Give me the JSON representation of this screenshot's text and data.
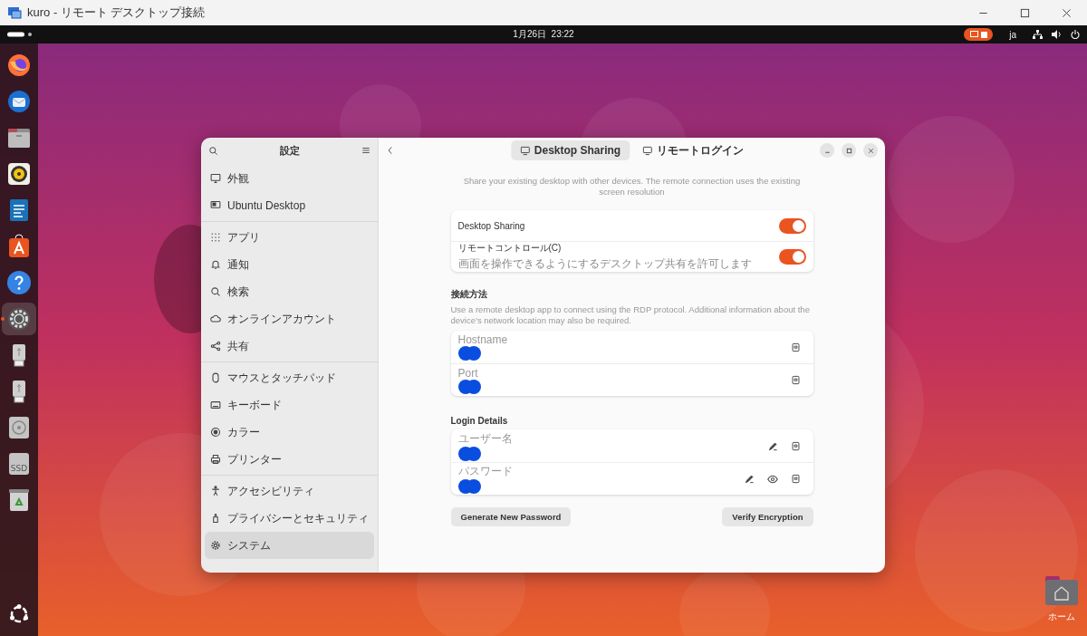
{
  "window": {
    "title": "kuro - リモート デスクトップ接続"
  },
  "top_bar": {
    "clock": "1月26日  23:22",
    "language": "ja",
    "recording": true
  },
  "dock": {
    "items": [
      {
        "kind": "firefox",
        "selected": false
      },
      {
        "kind": "thunderbird",
        "selected": false
      },
      {
        "kind": "files",
        "selected": false
      },
      {
        "kind": "rhythmbox",
        "selected": false
      },
      {
        "kind": "writer",
        "selected": false
      },
      {
        "kind": "appcenter",
        "selected": false
      },
      {
        "kind": "help",
        "selected": false
      },
      {
        "kind": "settings",
        "selected": true
      },
      {
        "kind": "usb",
        "selected": false
      },
      {
        "kind": "usb",
        "selected": false
      },
      {
        "kind": "disc",
        "selected": false
      },
      {
        "kind": "ssd",
        "selected": false,
        "label": "SSD"
      },
      {
        "kind": "trash",
        "selected": false
      }
    ]
  },
  "desktop_icons": [
    {
      "label": "ホーム"
    }
  ],
  "settings": {
    "title": "設定",
    "sidebar": {
      "groups": [
        [
          {
            "label": "外観",
            "kind": "appearance",
            "selected": false
          },
          {
            "label": "Ubuntu Desktop",
            "kind": "ubuntu",
            "selected": false
          }
        ],
        [
          {
            "label": "アプリ",
            "kind": "apps",
            "selected": false
          },
          {
            "label": "通知",
            "kind": "bell",
            "selected": false
          },
          {
            "label": "検索",
            "kind": "search",
            "selected": false
          },
          {
            "label": "オンラインアカウント",
            "kind": "cloud",
            "selected": false
          },
          {
            "label": "共有",
            "kind": "share",
            "selected": false
          }
        ],
        [
          {
            "label": "マウスとタッチパッド",
            "kind": "mouse",
            "selected": false
          },
          {
            "label": "キーボード",
            "kind": "keyboard",
            "selected": false
          },
          {
            "label": "カラー",
            "kind": "color",
            "selected": false
          },
          {
            "label": "プリンター",
            "kind": "printer",
            "selected": false
          }
        ],
        [
          {
            "label": "アクセシビリティ",
            "kind": "accessibility",
            "selected": false
          },
          {
            "label": "プライバシーとセキュリティ",
            "kind": "privacy",
            "selected": false
          },
          {
            "label": "システム",
            "kind": "system",
            "selected": true
          }
        ]
      ]
    },
    "tabs": [
      {
        "label": "Desktop Sharing",
        "selected": true
      },
      {
        "label": "リモートログイン",
        "selected": false
      }
    ],
    "intro": "Share your existing desktop with other devices. The remote connection uses the existing screen resolution",
    "toggles": [
      {
        "label": "Desktop Sharing",
        "on": true
      },
      {
        "label": "リモートコントロール(C)",
        "subtitle": "画面を操作できるようにするデスクトップ共有を許可します",
        "on": true
      }
    ],
    "sections": [
      {
        "title": "接続方法",
        "description": "Use a remote desktop app to connect using the RDP protocol. Additional information about the device’s network location may also be required.",
        "fields": [
          {
            "label": "Hostname",
            "kind": "plain"
          },
          {
            "label": "Port",
            "kind": "plain"
          }
        ]
      },
      {
        "title": "Login Details",
        "fields": [
          {
            "label": "ユーザー名",
            "kind": "editable"
          },
          {
            "label": "パスワード",
            "kind": "secret"
          }
        ]
      }
    ],
    "buttons": [
      "Generate New Password",
      "Verify Encryption"
    ]
  }
}
